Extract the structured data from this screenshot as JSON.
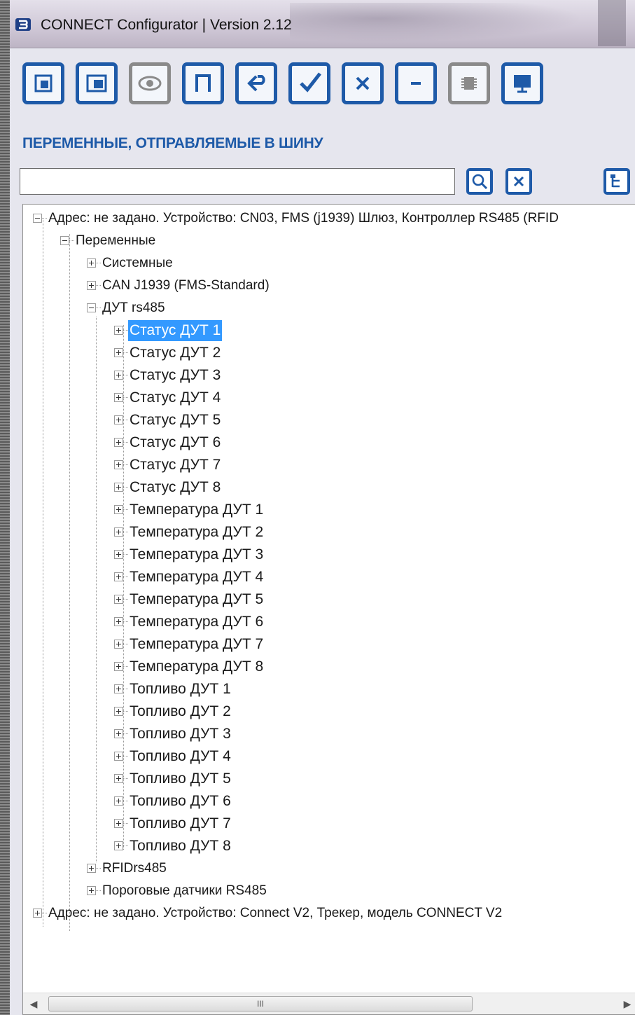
{
  "window": {
    "title": "CONNECT Configurator | Version 2.12"
  },
  "toolbar": {
    "buttons": [
      {
        "icon": "import-icon",
        "state": "active"
      },
      {
        "icon": "export-icon",
        "state": "active"
      },
      {
        "icon": "eye-icon",
        "state": "disabled"
      },
      {
        "icon": "p-icon",
        "state": "active"
      },
      {
        "icon": "back-icon",
        "state": "active"
      },
      {
        "icon": "checkmark-icon",
        "state": "active"
      },
      {
        "icon": "x-icon",
        "state": "active"
      },
      {
        "icon": "minus-icon",
        "state": "active"
      },
      {
        "icon": "chip-icon",
        "state": "disabled"
      },
      {
        "icon": "monitor-icon",
        "state": "active"
      }
    ]
  },
  "section": {
    "title": "ПЕРЕМЕННЫЕ, ОТПРАВЛЯЕМЫЕ В ШИНУ"
  },
  "search": {
    "value": "",
    "search_icon": "magnifier-icon",
    "clear_icon": "clear-x-icon",
    "tree_icon": "tree-view-icon"
  },
  "tree": {
    "root1": "Адрес: не задано. Устройство: CN03, FMS (j1939) Шлюз, Контроллер RS485 (RFID",
    "variables": "Переменные",
    "system": "Системные",
    "can": "CAN J1939 (FMS-Standard)",
    "dut": "ДУТ rs485",
    "dut_items": [
      "Статус ДУТ 1",
      "Статус ДУТ 2",
      "Статус ДУТ 3",
      "Статус ДУТ 4",
      "Статус ДУТ 5",
      "Статус ДУТ 6",
      "Статус ДУТ 7",
      "Статус ДУТ 8",
      "Температура ДУТ 1",
      "Температура ДУТ 2",
      "Температура ДУТ 3",
      "Температура ДУТ 4",
      "Температура ДУТ 5",
      "Температура ДУТ 6",
      "Температура ДУТ 7",
      "Температура ДУТ 8",
      "Топливо ДУТ 1",
      "Топливо ДУТ 2",
      "Топливо ДУТ 3",
      "Топливо ДУТ 4",
      "Топливо ДУТ 5",
      "Топливо ДУТ 6",
      "Топливо ДУТ 7",
      "Топливо ДУТ 8"
    ],
    "selected_item": "Статус ДУТ 1",
    "rfid": "RFIDrs485",
    "threshold": "Пороговые датчики RS485",
    "root2": "Адрес: не задано. Устройство: Connect V2, Трекер, модель CONNECT V2"
  },
  "scrollbar": {
    "thumb_grip": "III",
    "left_arrow": "◀",
    "right_arrow": "▶"
  },
  "colors": {
    "accent": "#1e5aa8",
    "selection": "#3399ff"
  }
}
